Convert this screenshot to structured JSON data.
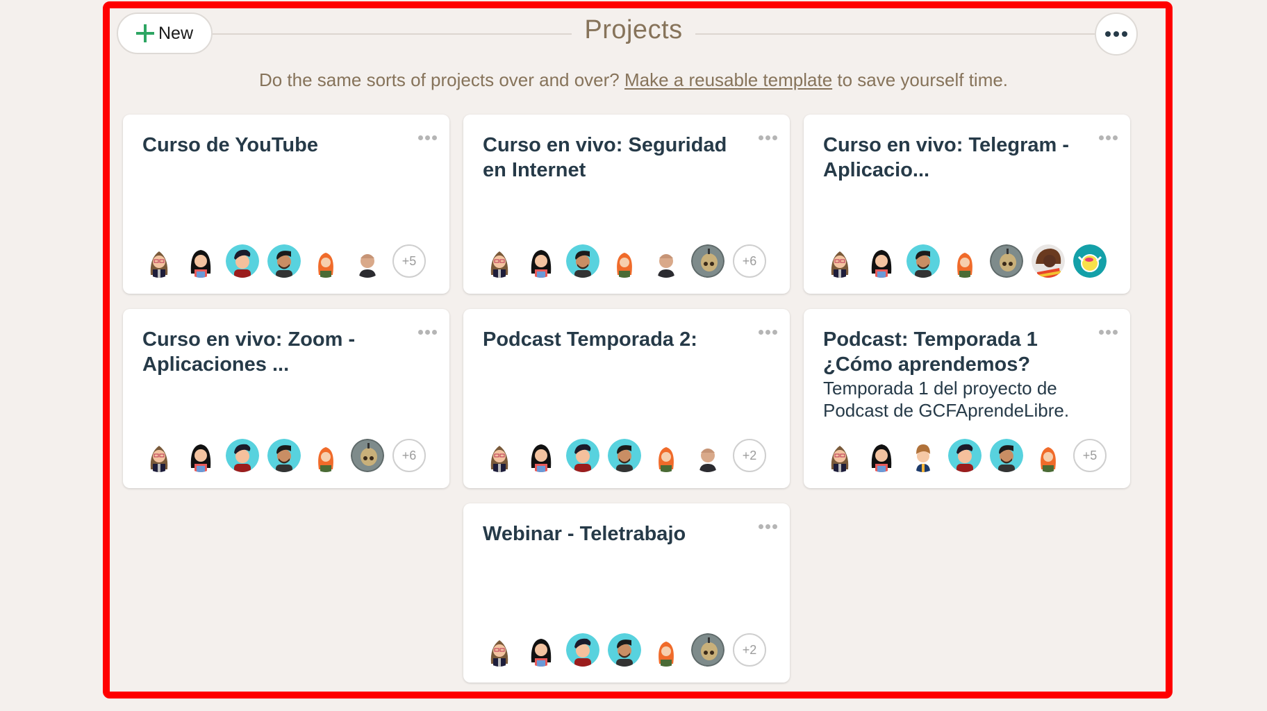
{
  "header": {
    "new_button_label": "New",
    "title": "Projects",
    "more_button": "more-options"
  },
  "subtitle": {
    "before": "Do the same sorts of projects over and over? ",
    "link": "Make a reusable template",
    "after": " to save yourself time."
  },
  "colors": {
    "accent_green": "#2da562",
    "title_brown": "#86735a",
    "card_title": "#263a48",
    "avatar_teal": "#58d2de"
  },
  "projects": [
    {
      "title": "Curso de YouTube",
      "description": "",
      "avatars": [
        "woman-glasses",
        "woman-dark-hair",
        "man-red-hoodie",
        "man-beard",
        "woman-red-hair",
        "man-bald"
      ],
      "extra_count": "+5"
    },
    {
      "title": "Curso en vivo: Seguridad en Internet",
      "description": "",
      "avatars": [
        "woman-glasses",
        "woman-dark-hair",
        "man-beard",
        "woman-red-hair",
        "man-bald",
        "skull-photo"
      ],
      "extra_count": "+6"
    },
    {
      "title": "Curso en vivo: Telegram - Aplicacio...",
      "description": "",
      "avatars": [
        "woman-glasses",
        "woman-dark-hair",
        "man-beard",
        "woman-red-hair",
        "skull-photo",
        "man-dreadlocks-photo",
        "yellow-monster"
      ],
      "extra_count": ""
    },
    {
      "title": "Curso en vivo: Zoom - Aplicaciones ...",
      "description": "",
      "avatars": [
        "woman-glasses",
        "woman-dark-hair",
        "man-red-hoodie",
        "man-beard",
        "woman-red-hair",
        "skull-photo"
      ],
      "extra_count": "+6"
    },
    {
      "title": "Podcast Temporada 2:",
      "description": "",
      "avatars": [
        "woman-glasses",
        "woman-dark-hair",
        "man-red-hoodie",
        "man-beard",
        "woman-red-hair",
        "man-bald"
      ],
      "extra_count": "+2"
    },
    {
      "title": "Podcast: Temporada 1 ¿Cómo aprendemos?",
      "description": "Temporada 1 del proyecto de Podcast de GCFAprendeLibre.",
      "avatars": [
        "woman-glasses",
        "woman-dark-hair",
        "man-blonde",
        "man-red-hoodie",
        "man-beard",
        "woman-red-hair"
      ],
      "extra_count": "+5"
    },
    {
      "title": "Webinar - Teletrabajo",
      "description": "",
      "avatars": [
        "woman-glasses",
        "woman-dark-hair",
        "man-red-hoodie",
        "man-beard",
        "woman-red-hair",
        "skull-photo"
      ],
      "extra_count": "+2"
    }
  ]
}
